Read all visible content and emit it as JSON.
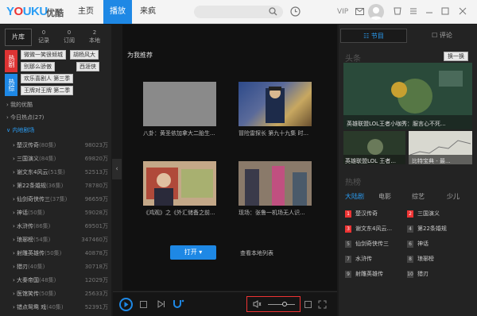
{
  "app": {
    "logo_brand": "YOUKU",
    "logo_cn": "优酷"
  },
  "nav": {
    "tabs": [
      {
        "label": "主页"
      },
      {
        "label": "播放"
      },
      {
        "label": "来疯"
      }
    ],
    "vip": "VIP"
  },
  "left": {
    "tabs": [
      {
        "label": "片库"
      },
      {
        "count": "0",
        "label": "记录"
      },
      {
        "count": "0",
        "label": "订阅"
      },
      {
        "count": "2",
        "label": "本地"
      }
    ],
    "badges": [
      {
        "label": "热剧"
      },
      {
        "label": "热综"
      }
    ],
    "tags": [
      "微微一笑很倾城",
      "胡杨风大",
      "别那么骄傲",
      "西涯侠",
      "欢乐喜剧人 第三季",
      "王牌对王牌 第二季"
    ],
    "nav": [
      {
        "label": "我的优酷"
      },
      {
        "label": "今日热点(27)"
      },
      {
        "label": "内地剧场"
      }
    ],
    "list": [
      {
        "title": "楚汉传奇",
        "count": "(80集)",
        "views": "98023万"
      },
      {
        "title": "三国演义",
        "count": "(84集)",
        "views": "69820万"
      },
      {
        "title": "谢文东4风云",
        "count": "(51集)",
        "views": "52513万"
      },
      {
        "title": "第22条婚规",
        "count": "(36集)",
        "views": "78780万"
      },
      {
        "title": "仙剑奇侠传三",
        "count": "(37集)",
        "views": "96659万"
      },
      {
        "title": "神话",
        "count": "(50集)",
        "views": "59028万"
      },
      {
        "title": "水浒传",
        "count": "(86集)",
        "views": "69501万"
      },
      {
        "title": "琅琊榜",
        "count": "(54集)",
        "views": "347460万"
      },
      {
        "title": "射雕英雄传",
        "count": "(50集)",
        "views": "40878万"
      },
      {
        "title": "猎刃",
        "count": "(40集)",
        "views": "30718万"
      },
      {
        "title": "大秦帝国",
        "count": "(48集)",
        "views": "12029万"
      },
      {
        "title": "医馆笑传",
        "count": "(50集)",
        "views": "25633万"
      },
      {
        "title": "错点鸳鸯 戏",
        "count": "(40集)",
        "views": "52391万"
      }
    ]
  },
  "center": {
    "rec_title": "为我推荐",
    "cards": [
      {
        "caption": "八卦：黄圣依加拿大二胎生..."
      },
      {
        "caption": "冒险雷探长 第九十九集 时..."
      },
      {
        "caption": "《鸿观》之《外汇储备之前..."
      },
      {
        "caption": "现场：张鲁一机场无人识..."
      }
    ],
    "open_label": "打开 ▾",
    "local_label": "查看本地列表"
  },
  "player": {
    "volume": 0.62
  },
  "right": {
    "tabs": [
      {
        "label": "节目"
      },
      {
        "label": "评论"
      }
    ],
    "headline_title": "头条",
    "change_label": "换一换",
    "main_caption": "英雄联盟LOL王者小咖秀：服言心不死...",
    "small_captions": [
      "英雄联盟LOL 王者...",
      "比特宝典 - 最..."
    ],
    "hot_title": "热榜",
    "categories": [
      {
        "label": "大陆剧"
      },
      {
        "label": "电影"
      },
      {
        "label": "综艺"
      },
      {
        "label": "少儿"
      }
    ],
    "ranks": [
      {
        "n": "1",
        "title": "楚汉传奇"
      },
      {
        "n": "2",
        "title": "三国演义"
      },
      {
        "n": "3",
        "title": "谢文东4风云..."
      },
      {
        "n": "4",
        "title": "第22条婚规"
      },
      {
        "n": "5",
        "title": "仙剑奇侠传三"
      },
      {
        "n": "6",
        "title": "神话"
      },
      {
        "n": "7",
        "title": "水浒传"
      },
      {
        "n": "8",
        "title": "琅琊榜"
      },
      {
        "n": "9",
        "title": "射雕英雄传"
      },
      {
        "n": "10",
        "title": "猎刃"
      }
    ]
  },
  "colors": {
    "accent": "#1e88e5",
    "hot": "#e33333",
    "highlight_box": "#e33333"
  }
}
